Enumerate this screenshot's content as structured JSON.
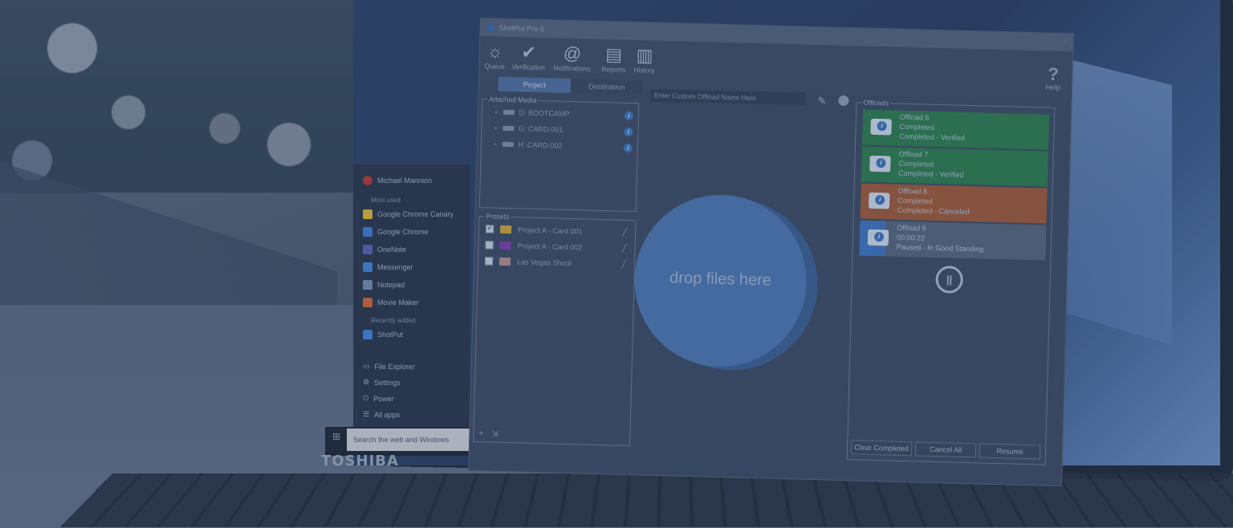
{
  "app": {
    "title": "ShotPut Pro 6",
    "window_controls": [
      "–",
      "☐",
      "✕"
    ]
  },
  "toolbar": {
    "items": [
      {
        "label": "Queue",
        "icon": "sun-gear-icon"
      },
      {
        "label": "Verification",
        "icon": "checkmark-icon"
      },
      {
        "label": "Notifications",
        "icon": "at-sign-icon"
      },
      {
        "label": "Reports",
        "icon": "report-icon"
      },
      {
        "label": "History",
        "icon": "clipboard-icon"
      }
    ],
    "help_label": "Help"
  },
  "tabs": [
    {
      "label": "Project",
      "active": true
    },
    {
      "label": "Destination",
      "active": false
    }
  ],
  "custom_name_placeholder": "Enter Custom Offload Name Here",
  "attached_media": {
    "legend": "Attached Media",
    "items": [
      {
        "label": "D: BOOTCAMP"
      },
      {
        "label": "G: CARD-001"
      },
      {
        "label": "H: CARD-002"
      }
    ]
  },
  "presets": {
    "legend": "Presets",
    "items": [
      {
        "label": "Project A - Card 001",
        "checked": true,
        "color": "#c9a23a"
      },
      {
        "label": "Project A - Card 002",
        "checked": false,
        "color": "#7a3fa8"
      },
      {
        "label": "Las Vegas Shoot",
        "checked": false,
        "color": "#b08a8a"
      }
    ],
    "add_label": "+",
    "import_label": "⇲"
  },
  "dropzone": {
    "label": "drop files here"
  },
  "offloads": {
    "legend": "Offloads",
    "items": [
      {
        "name": "Offload 6",
        "line2": "Completed",
        "line3": "Completed - Verified",
        "state": "green"
      },
      {
        "name": "Offload 7",
        "line2": "Completed",
        "line3": "Completed - Verified",
        "state": "green"
      },
      {
        "name": "Offload 8",
        "line2": "Completed",
        "line3": "Completed - Canceled",
        "state": "orange"
      },
      {
        "name": "Offload 9",
        "line2": "00:00:22",
        "line3": "Paused - In Good Standing",
        "state": "gray",
        "progress": 0.14
      }
    ],
    "pause_icon": "pause-circle-icon",
    "buttons": {
      "clear": "Clear Completed",
      "cancel": "Cancel All",
      "resume": "Resume"
    }
  },
  "start_menu": {
    "user": "Michael Mannion",
    "section_most_used": "Most used",
    "items": [
      {
        "label": "Google Chrome Canary",
        "color": "#d8b23a"
      },
      {
        "label": "Google Chrome",
        "color": "#3f7ad1"
      },
      {
        "label": "OneNote",
        "color": "#5b5fb0"
      },
      {
        "label": "Messenger",
        "color": "#3f84d6"
      },
      {
        "label": "Notepad",
        "color": "#6f8bb0"
      },
      {
        "label": "Movie Maker",
        "color": "#c9643a"
      }
    ],
    "section_recent": "Recently added",
    "recent_item": "ShotPut",
    "system_items": [
      "File Explorer",
      "Settings",
      "Power",
      "All apps"
    ]
  },
  "taskbar": {
    "search_placeholder": "Search the web and Windows"
  },
  "laptop_brand": "TOSHIBA",
  "colors": {
    "accent": "#4b76b0",
    "completed": "#2e7a4f",
    "canceled": "#9a5a3a",
    "paused": "#55647b"
  }
}
